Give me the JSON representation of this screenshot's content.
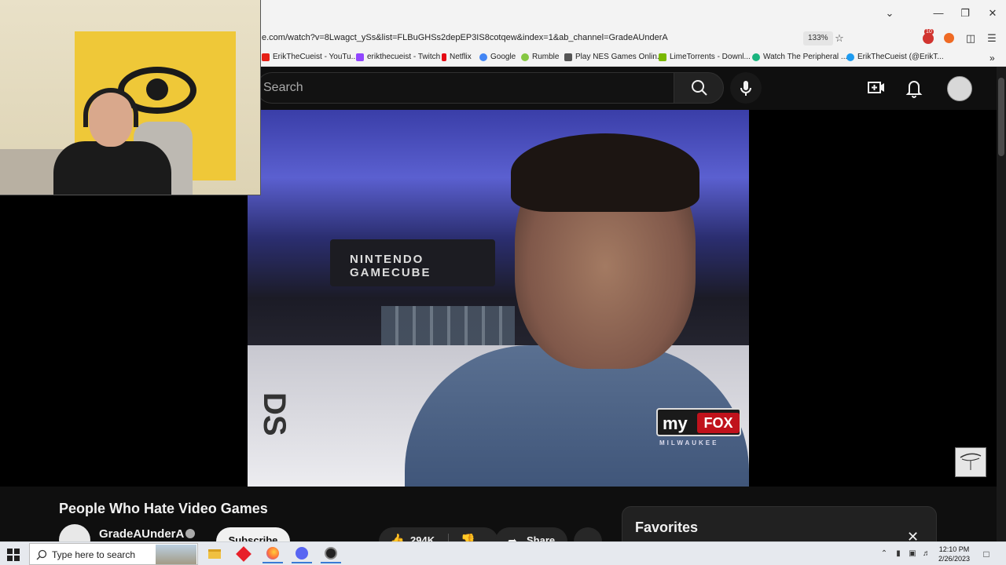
{
  "browser": {
    "url": "e.com/watch?v=8Lwagct_ySs&list=FLBuGHSs2depEP3IS8cotqew&index=1&ab_channel=GradeAUnderA",
    "zoom": "133%",
    "extension_badge": "10",
    "bookmarks": [
      {
        "label": "ErikTheCueist - YouTu...",
        "color": "#e62117"
      },
      {
        "label": "erikthecueist - Twitch",
        "color": "#9146ff"
      },
      {
        "label": "Netflix",
        "color": "#e50914"
      },
      {
        "label": "Google",
        "color": "#4285f4"
      },
      {
        "label": "Rumble",
        "color": "#85c742"
      },
      {
        "label": "Play NES Games Onlin...",
        "color": "#555555"
      },
      {
        "label": "LimeTorrents - Downl...",
        "color": "#7ab800"
      },
      {
        "label": "Watch The Peripheral ...",
        "color": "#19b47e"
      },
      {
        "label": "ErikTheCueist (@ErikT...",
        "color": "#1d9bf0"
      }
    ]
  },
  "header": {
    "search_placeholder": "Search"
  },
  "video": {
    "title": "People Who Hate Video Games",
    "sign_text": "NINTENDO GAMECUBE",
    "ds_text": "DS",
    "logo_my": "my",
    "logo_fox": "FOX",
    "logo_city": "MILWAUKEE"
  },
  "channel": {
    "name": "GradeAUnderA",
    "subscribe_label": "Subscribe"
  },
  "actions": {
    "likes": "294K",
    "share_label": "Share",
    "more_label": "..."
  },
  "favorites_panel": {
    "title": "Favorites"
  },
  "taskbar": {
    "search_text": "Type here to search",
    "time": "12:10 PM",
    "date": "2/26/2023"
  }
}
